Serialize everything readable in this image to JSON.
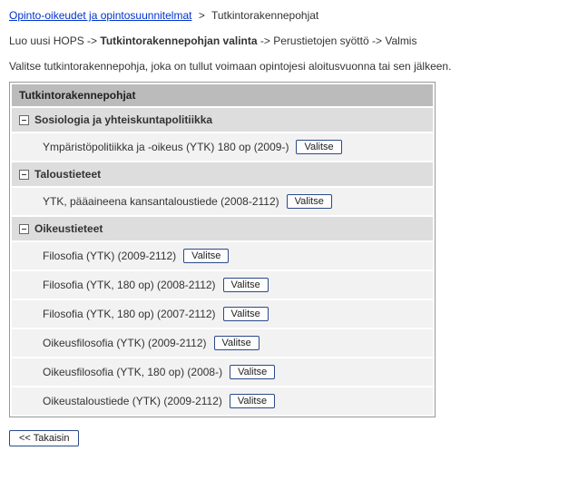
{
  "breadcrumb": {
    "link": "Opinto-oikeudet ja opintosuunnitelmat",
    "sep": ">",
    "current": "Tutkintorakennepohjat"
  },
  "wizard": {
    "prefix": "Luo uusi HOPS ->",
    "current": "Tutkintorakennepohjan valinta",
    "arrow": "->",
    "step3": "Perustietojen syöttö",
    "step4": "Valmis"
  },
  "instruction": "Valitse tutkintorakennepohja, joka on tullut voimaan opintojesi aloitusvuonna tai sen jälkeen.",
  "panel": {
    "header": "Tutkintorakennepohjat",
    "groups": [
      {
        "title": "Sosiologia ja yhteiskuntapolitiikka",
        "items": [
          {
            "label": "Ympäristöpolitiikka ja -oikeus (YTK) 180 op  (2009-)",
            "button": "Valitse"
          }
        ]
      },
      {
        "title": "Taloustieteet",
        "items": [
          {
            "label": "YTK, pääaineena kansantaloustiede (2008-2112)",
            "button": "Valitse"
          }
        ]
      },
      {
        "title": "Oikeustieteet",
        "items": [
          {
            "label": "Filosofia (YTK) (2009-2112)",
            "button": "Valitse"
          },
          {
            "label": "Filosofia (YTK, 180 op) (2008-2112)",
            "button": "Valitse"
          },
          {
            "label": "Filosofia (YTK, 180 op)  (2007-2112)",
            "button": "Valitse"
          },
          {
            "label": "Oikeusfilosofia (YTK) (2009-2112)",
            "button": "Valitse"
          },
          {
            "label": "Oikeusfilosofia (YTK, 180 op) (2008-)",
            "button": "Valitse"
          },
          {
            "label": "Oikeustaloustiede (YTK) (2009-2112)",
            "button": "Valitse"
          }
        ]
      }
    ]
  },
  "back_button": "<< Takaisin"
}
